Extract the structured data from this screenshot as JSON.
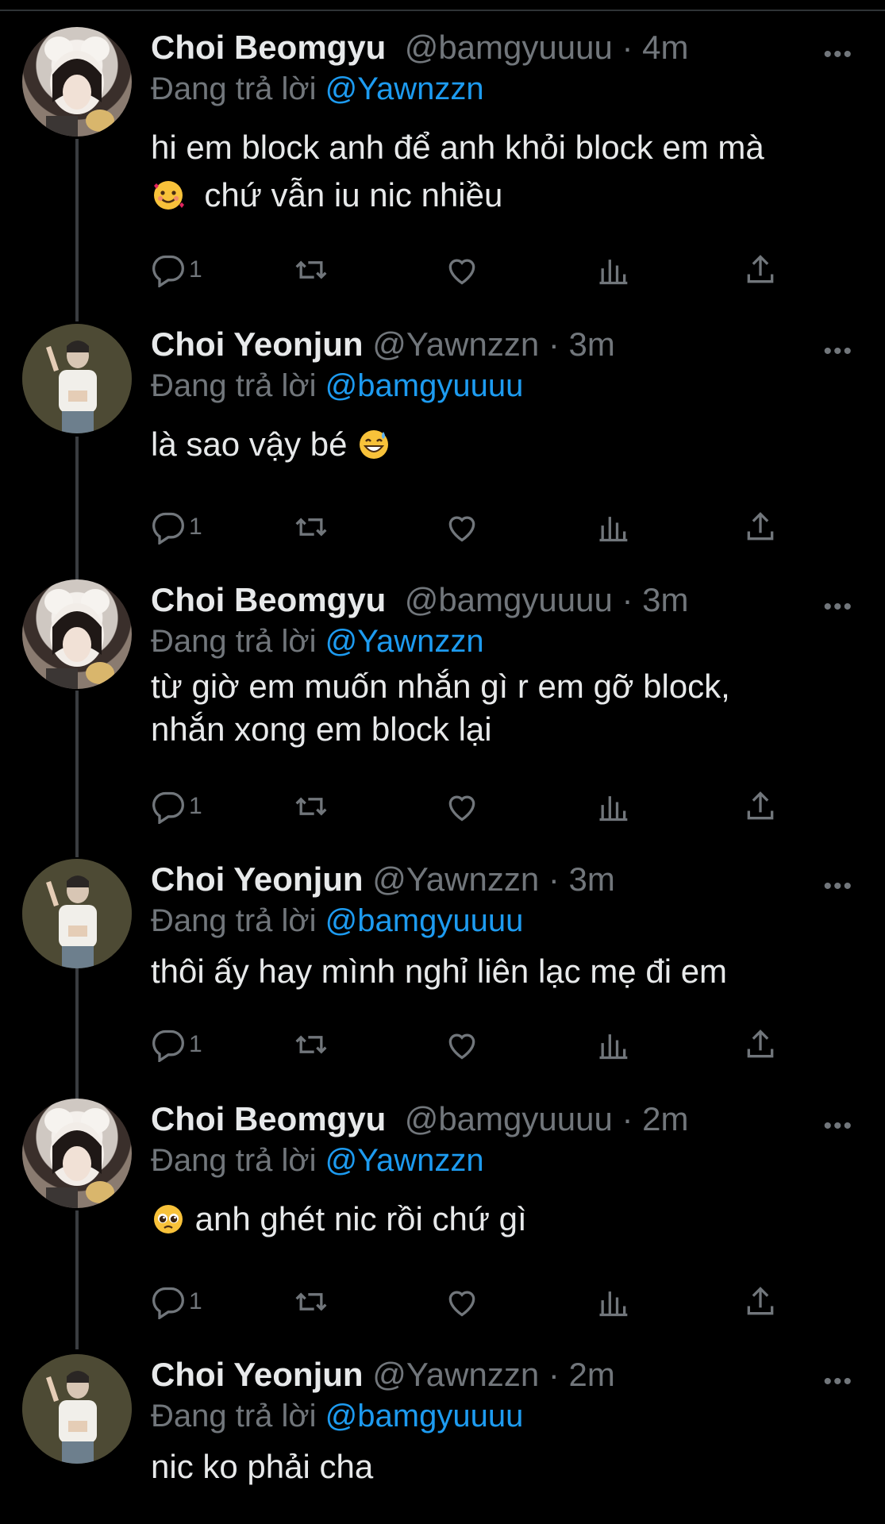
{
  "tweets": [
    {
      "author": "Choi Beomgyu",
      "handle": "@bamgyuuuu",
      "time": "4m",
      "replying_prefix": "Đang trả lời",
      "replying_to": "@Yawnzzn",
      "text_line1": "hi em block anh để anh khỏi block em mà",
      "text_line2": "chứ vẫn iu nic nhiều",
      "emoji": "smiling-face-with-hearts",
      "reply_count": "1"
    },
    {
      "author": "Choi Yeonjun",
      "handle": "@Yawnzzn",
      "time": "3m",
      "replying_prefix": "Đang trả lời",
      "replying_to": "@bamgyuuuu",
      "text_line1": "là sao vậy bé",
      "emoji": "grinning-face-with-sweat",
      "reply_count": "1"
    },
    {
      "author": "Choi Beomgyu",
      "handle": "@bamgyuuuu",
      "time": "3m",
      "replying_prefix": "Đang trả lời",
      "replying_to": "@Yawnzzn",
      "text_line1": "từ giờ em muốn nhắn gì r em gỡ block,",
      "text_line2": "nhắn xong em block lại",
      "reply_count": "1"
    },
    {
      "author": "Choi Yeonjun",
      "handle": "@Yawnzzn",
      "time": "3m",
      "replying_prefix": "Đang trả lời",
      "replying_to": "@bamgyuuuu",
      "text_line1": "thôi ấy hay mình nghỉ liên lạc mẹ đi em",
      "reply_count": "1"
    },
    {
      "author": "Choi Beomgyu",
      "handle": "@bamgyuuuu",
      "time": "2m",
      "replying_prefix": "Đang trả lời",
      "replying_to": "@Yawnzzn",
      "text_line1": "anh ghét nic rồi chứ gì",
      "emoji": "pleading-face",
      "reply_count": "1"
    },
    {
      "author": "Choi Yeonjun",
      "handle": "@Yawnzzn",
      "time": "2m",
      "replying_prefix": "Đang trả lời",
      "replying_to": "@bamgyuuuu",
      "text_line1": "nic ko phải cha"
    }
  ],
  "separator": "·",
  "colors": {
    "background": "#000000",
    "text": "#e7e9ea",
    "muted": "#71767b",
    "mention": "#1d9bf0",
    "thread_line": "#3a3d41"
  }
}
